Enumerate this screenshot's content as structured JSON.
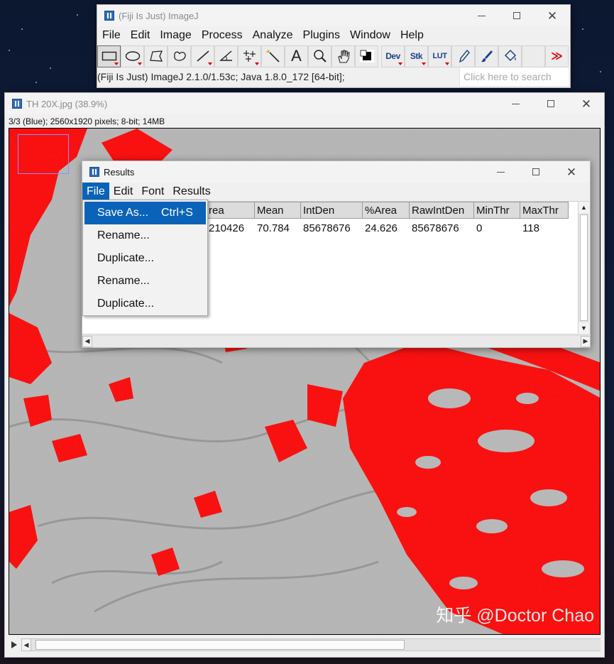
{
  "imagej": {
    "title": "(Fiji Is Just) ImageJ",
    "menu": [
      "File",
      "Edit",
      "Image",
      "Process",
      "Analyze",
      "Plugins",
      "Window",
      "Help"
    ],
    "tools": {
      "dev_label": "Dev",
      "stk_label": "Stk",
      "lut_label": "LUT",
      "text_tool_glyph": "A"
    },
    "status": "(Fiji Is Just) ImageJ 2.1.0/1.53c; Java 1.8.0_172 [64-bit];",
    "search_placeholder": "Click here to search"
  },
  "image_window": {
    "title": "TH 20X.jpg (38.9%)",
    "info": "3/3 (Blue); 2560x1920 pixels; 8-bit; 14MB",
    "watermark": "知乎 @Doctor Chao",
    "colors": {
      "threshold": "#ff0000",
      "background_gray": "#b5b5b5"
    }
  },
  "results": {
    "title": "Results",
    "menu": [
      "File",
      "Edit",
      "Font",
      "Results"
    ],
    "open_menu": "File",
    "columns": [
      "rea",
      "Mean",
      "IntDen",
      "%Area",
      "RawIntDen",
      "MinThr",
      "MaxThr"
    ],
    "row": [
      "210426",
      "70.784",
      "85678676",
      "24.626",
      "85678676",
      "0",
      "118"
    ],
    "file_menu": [
      {
        "label": "Save As...",
        "shortcut": "Ctrl+S"
      },
      {
        "label": "Rename...",
        "shortcut": ""
      },
      {
        "label": "Duplicate...",
        "shortcut": ""
      },
      {
        "label": "Rename...",
        "shortcut": ""
      },
      {
        "label": "Duplicate...",
        "shortcut": ""
      }
    ]
  }
}
